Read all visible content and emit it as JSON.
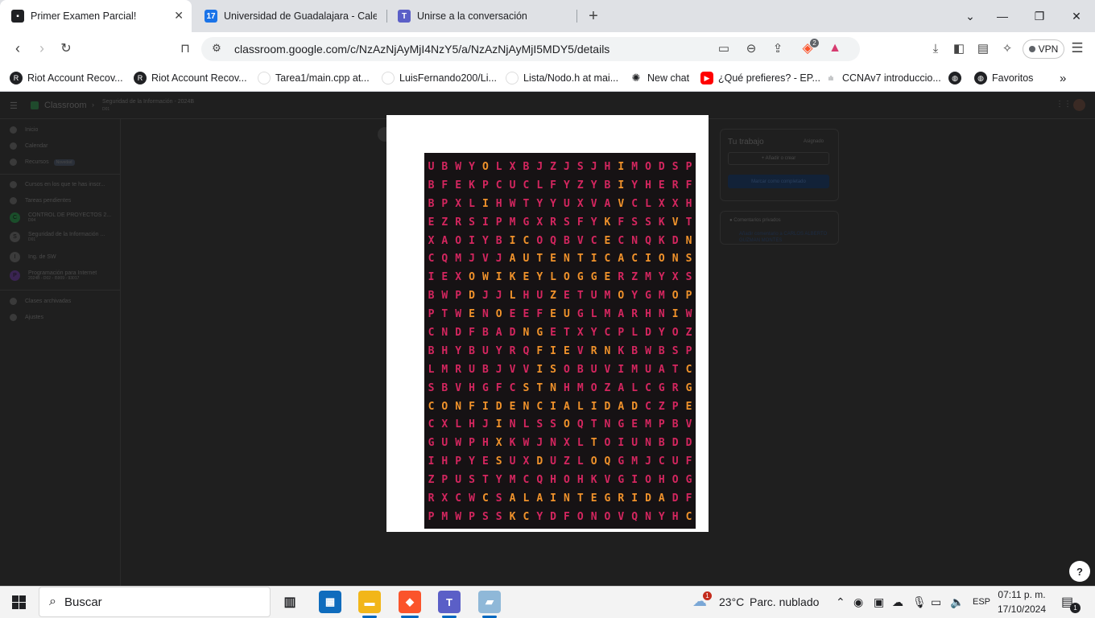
{
  "browser": {
    "tabs": [
      {
        "title": "Primer Examen Parcial!",
        "icon": "classroom-icon",
        "active": true
      },
      {
        "title": "Universidad de Guadalajara - Calend",
        "icon": "calendar-icon",
        "active": false
      },
      {
        "title": "Unirse a la conversación",
        "icon": "teams-icon",
        "active": false
      }
    ],
    "url": "classroom.google.com/c/NzAzNjAyMjI4NzY5/a/NzAzNjAyMjI5MDY5/details",
    "vpn_label": "VPN",
    "brave_badge": "2",
    "bookmarks": [
      {
        "label": "Riot Account Recov...",
        "icon": "riot-icon",
        "color": "#202124"
      },
      {
        "label": "Riot Account Recov...",
        "icon": "riot-icon",
        "color": "#202124"
      },
      {
        "label": "Tarea1/main.cpp at...",
        "icon": "github-icon",
        "color": "#ffffff"
      },
      {
        "label": "LuisFernando200/Li...",
        "icon": "github-icon",
        "color": "#ffffff"
      },
      {
        "label": "Lista/Nodo.h at mai...",
        "icon": "github-icon",
        "color": "#ffffff"
      },
      {
        "label": "New chat",
        "icon": "openai-icon",
        "color": "#ffffff"
      },
      {
        "label": "¿Qué prefieres? - EP...",
        "icon": "youtube-icon",
        "color": "#ff0000"
      },
      {
        "label": "CCNAv7 introduccio...",
        "icon": "cisco-icon",
        "color": "#ffffff"
      },
      {
        "label": "",
        "icon": "globe-icon",
        "color": "#202124"
      },
      {
        "label": "Favoritos",
        "icon": "globe-icon",
        "color": "#202124"
      }
    ]
  },
  "classroom": {
    "app_name": "Classroom",
    "class_title": "Seguridad de la Información - 2024B",
    "class_subtitle": "D01",
    "nav": [
      {
        "label": "Inicio"
      },
      {
        "label": "Calendar"
      },
      {
        "label": "Recursos",
        "badge": "Novedad"
      }
    ],
    "enrolled_header": "Cursos en los que te has inscr...",
    "pending": "Tareas pendientes",
    "courses": [
      {
        "initial": "C",
        "name": "CONTROL DE PROYECTOS 2...",
        "sub": "D04",
        "color": "#1e8e3e"
      },
      {
        "initial": "S",
        "name": "Seguridad de la Información ...",
        "sub": "D01",
        "color": "#5f6368"
      },
      {
        "initial": "I",
        "name": "Ing. de SW",
        "sub": "",
        "color": "#5f6368"
      },
      {
        "initial": "P",
        "name": "Programación para Internet",
        "sub": "2024B - D02 - I5909 - 93017",
        "color": "#8430ce"
      }
    ],
    "archived": "Clases archivadas",
    "settings": "Ajustes",
    "your_work": {
      "title": "Tu trabajo",
      "status": "Asignado",
      "add_button": "+ Añadir o crear",
      "mark_button": "Marcar como completado"
    },
    "private_comments": {
      "title": "Comentarios privados",
      "link": "Añadir comentario a CARLOS ALBERTO GUZMAN MONTES"
    }
  },
  "puzzle": {
    "rows": [
      "UBWYOLXBJZJSJHIMODSP",
      "BFEKPCUCLFYZYBIYHERF",
      "BPXLIHWTYYUXVAVCLXXH",
      "EZRSIPMGXRSFYKFSSKVT",
      "XAOIYBICOQBVCECNQKDN",
      "CQMJVJAUTENTICACIONS",
      "IEXOWIKEYLOGGERZMYXS",
      "BWPDJJLHUZETUMOYGMOP",
      "PTWENOEEFEUGLMARHNIW",
      "CNDFBADNGETXYCPLDYOZ",
      "BHYBUYRQFIEVRNKBWBSP",
      "LMRUBJVVISOBUVIMUATC",
      "SBVHGFCSTNHMOZALCGRG",
      "CONFIDENCIALIDADCZPE",
      "CXLHJINLSSOQTNGEMPBV",
      "GUWPHXKWJNXLTOIUNBDD",
      "IHPYESUXDUZLOQGMJCUF",
      "ZPUSTYMCQHOHKVGIOHOG",
      "RXCWCSALAINTEGRIDADF",
      "PMWPSSKCYDFONOVQNYHC"
    ],
    "highlight_mask": [
      "00001000000000100000",
      "00000000000000100000",
      "00001000000000100000",
      "00000000000001000010",
      "00000011000001000001",
      "00000011111111111111",
      "00011111111111000000",
      "00010010010000100011",
      "00010100011000000010",
      "00000001100000000000",
      "00000000111011000000",
      "00000000110000000001",
      "00000001110000000001",
      "11111111111111110001",
      "00000100001000000000",
      "00000100000010000000",
      "00000100100011000000",
      "00000000000000000000",
      "00001011111111111100",
      "00000011000000000001"
    ]
  },
  "taskbar": {
    "search_placeholder": "Buscar",
    "weather_temp": "23°C",
    "weather_desc": "Parc. nublado",
    "weather_badge": "1",
    "language": "ESP",
    "time": "07:11 p. m.",
    "date": "17/10/2024",
    "notification_count": "1"
  },
  "colors": {
    "puzzle_bg": "#161214",
    "letter_default": "#d4265f",
    "letter_highlight": "#f0922b",
    "taskbar_accent": "#0067c0"
  }
}
